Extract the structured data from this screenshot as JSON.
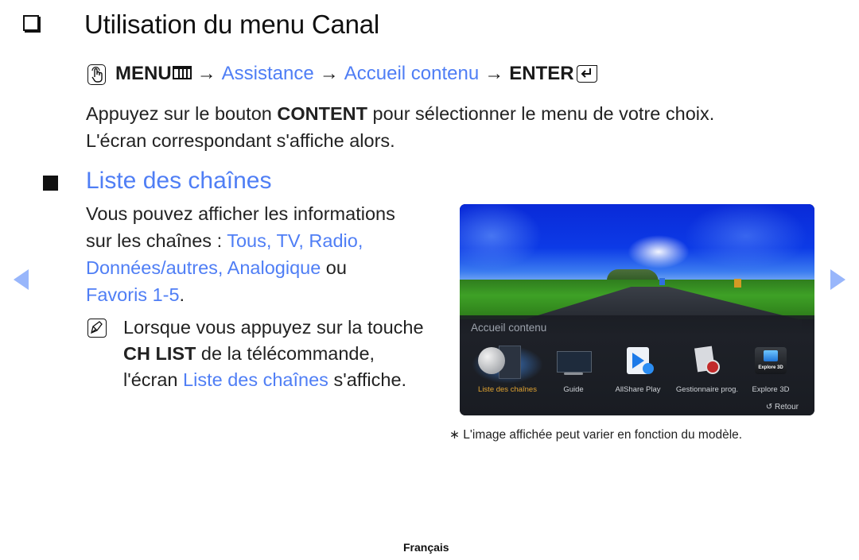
{
  "page": {
    "title": "Utilisation du menu Canal",
    "menu_path": {
      "menu_label": "MENU",
      "arrow": "→",
      "step1": "Assistance",
      "step2": "Accueil contenu",
      "enter_label": "ENTER",
      "icons": [
        "remote-hand-icon",
        "menu-grid-icon",
        "enter-icon"
      ]
    },
    "intro": {
      "line1_before": "Appuyez sur le bouton ",
      "line1_key": "CONTENT",
      "line1_after": " pour sélectionner le menu de votre choix.",
      "line2": "L'écran correspondant s'affiche alors."
    },
    "section": {
      "title": "Liste des chaînes",
      "body": {
        "line1": "Vous pouvez afficher les informations",
        "line2_before": "sur les chaînes : ",
        "line2_blue": "Tous, TV, Radio,",
        "line3_blue": "Données/autres, Analogique",
        "line3_after": " ou",
        "line4_blue": "Favoris 1-5",
        "line4_after": "."
      },
      "note": {
        "line1": "Lorsque vous appuyez sur la touche",
        "line2_key": "CH LIST",
        "line2_after": " de la télécommande,",
        "line3_before": "l'écran ",
        "line3_blue": "Liste des chaînes",
        "line3_after": " s'affiche."
      }
    },
    "tv_screen": {
      "panel_title": "Accueil contenu",
      "items": [
        {
          "label": "Liste des chaînes",
          "icon": "satellite-dish-icon",
          "selected": true
        },
        {
          "label": "Guide",
          "icon": "tv-guide-icon",
          "selected": false
        },
        {
          "label": "AllShare Play",
          "icon": "allshare-play-icon",
          "selected": false
        },
        {
          "label": "Gestionnaire prog.",
          "icon": "schedule-clock-icon",
          "selected": false
        },
        {
          "label": "Explore 3D",
          "icon": "explore-3d-icon",
          "selected": false
        }
      ],
      "explore_badge": "Explore 3D",
      "return_label": "Retour",
      "return_icon": "↺"
    },
    "disclaimer": "∗ L'image affichée peut varier en fonction du modèle.",
    "footer_language": "Français",
    "colors": {
      "accent_blue": "#4f7ef5",
      "selected_orange": "#e2a431",
      "nav_arrow": "#98b6fb"
    }
  }
}
